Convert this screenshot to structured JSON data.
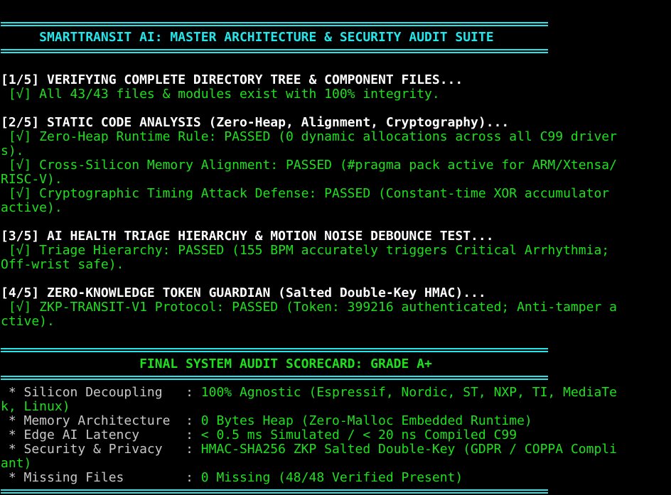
{
  "header": {
    "title": "     SMARTTRANSIT AI: MASTER ARCHITECTURE & SECURITY AUDIT SUITE"
  },
  "steps": [
    {
      "heading": "[1/5] VERIFYING COMPLETE DIRECTORY TREE & COMPONENT FILES...",
      "lines": [
        " [√] All 43/43 files & modules exist with 100% integrity."
      ]
    },
    {
      "heading": "[2/5] STATIC CODE ANALYSIS (Zero-Heap, Alignment, Cryptography)...",
      "lines": [
        " [√] Zero-Heap Runtime Rule: PASSED (0 dynamic allocations across all C99 driver",
        "s).",
        " [√] Cross-Silicon Memory Alignment: PASSED (#pragma pack active for ARM/Xtensa/",
        "RISC-V).",
        " [√] Cryptographic Timing Attack Defense: PASSED (Constant-time XOR accumulator",
        "active)."
      ]
    },
    {
      "heading": "[3/5] AI HEALTH TRIAGE HIERARCHY & MOTION NOISE DEBOUNCE TEST...",
      "lines": [
        " [√] Triage Hierarchy: PASSED (155 BPM accurately triggers Critical Arrhythmia;",
        "Off-wrist safe)."
      ]
    },
    {
      "heading": "[4/5] ZERO-KNOWLEDGE TOKEN GUARDIAN (Salted Double-Key HMAC)...",
      "lines": [
        " [√] ZKP-TRANSIT-V1 Protocol: PASSED (Token: 399216 authenticated; Anti-tamper a",
        "ctive)."
      ]
    }
  ],
  "scorecard": {
    "title": "                  FINAL SYSTEM AUDIT SCORECARD: GRADE A+",
    "rows": [
      {
        "label": " * Silicon Decoupling   : ",
        "value": "100% Agnostic (Espressif, Nordic, ST, NXP, TI, MediaTe",
        "cont": "k, Linux)"
      },
      {
        "label": " * Memory Architecture  : ",
        "value": "0 Bytes Heap (Zero-Malloc Embedded Runtime)",
        "cont": ""
      },
      {
        "label": " * Edge AI Latency      : ",
        "value": "< 0.5 ms Simulated / < 20 ns Compiled C99",
        "cont": ""
      },
      {
        "label": " * Security & Privacy   : ",
        "value": "HMAC-SHA256 ZKP Salted Double-Key (GDPR / COPPA Compli",
        "cont": "ant)"
      },
      {
        "label": " * Missing Files        : ",
        "value": "0 Missing (48/48 Verified Present)",
        "cont": ""
      }
    ]
  },
  "colors": {
    "background": "#000000",
    "accent": "#22e6ea",
    "success": "#1ee01e",
    "heading": "#ffffff",
    "muted": "#c8c8c8"
  }
}
